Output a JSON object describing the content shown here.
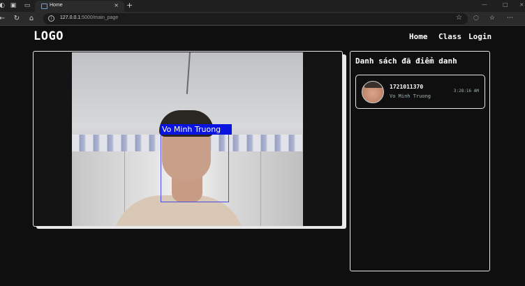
{
  "browser": {
    "tab_title": "Home",
    "tab_close": "×",
    "new_tab": "+",
    "url_host": "127.0.0.1",
    "url_path": ":5000/main_page",
    "icons": [
      "profile-icon",
      "workspaces-icon",
      "tab-actions-icon",
      "back-icon",
      "refresh-icon",
      "home-icon",
      "info-icon",
      "star-icon",
      "extensions-icon",
      "favorites-icon",
      "more-icon"
    ]
  },
  "header": {
    "logo": "LOGO",
    "nav": [
      "Home",
      "Class",
      "Login"
    ]
  },
  "camera": {
    "detection_label": "Vo Minh Truong",
    "box_color": "#0a14e0"
  },
  "attendance": {
    "title": "Danh sách đã điểm danh",
    "entries": [
      {
        "id": "1721011370",
        "name": "Vo Minh Truong",
        "time": "3:28:16 AM"
      }
    ]
  }
}
